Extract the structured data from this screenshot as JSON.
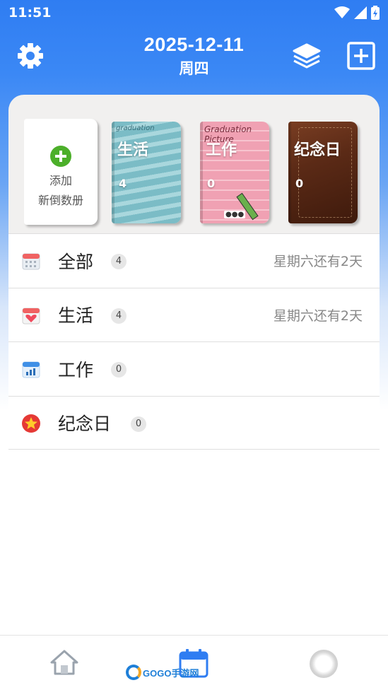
{
  "status_bar": {
    "time": "11:51"
  },
  "header": {
    "date": "2025-12-11",
    "weekday": "周四"
  },
  "books": {
    "add": {
      "line1": "添加",
      "line2": "新倒数册"
    },
    "items": [
      {
        "title": "生活",
        "count": "4",
        "deco": "graduation"
      },
      {
        "title": "工作",
        "count": "0",
        "deco": "Graduation Picture"
      },
      {
        "title": "纪念日",
        "count": "0"
      }
    ]
  },
  "list": {
    "rows": [
      {
        "label": "全部",
        "count": "4",
        "hint": "星期六还有2天",
        "icon": "calendar-grid-icon"
      },
      {
        "label": "生活",
        "count": "4",
        "hint": "星期六还有2天",
        "icon": "calendar-heart-icon"
      },
      {
        "label": "工作",
        "count": "0",
        "hint": "",
        "icon": "calendar-chart-icon"
      },
      {
        "label": "纪念日",
        "count": "0",
        "hint": "",
        "icon": "star-circle-icon"
      }
    ]
  },
  "watermark": {
    "text": "GOGO手游网"
  },
  "colors": {
    "primary": "#2f7df2",
    "accent_green": "#4caf2a",
    "anniversary_red": "#e53935"
  }
}
